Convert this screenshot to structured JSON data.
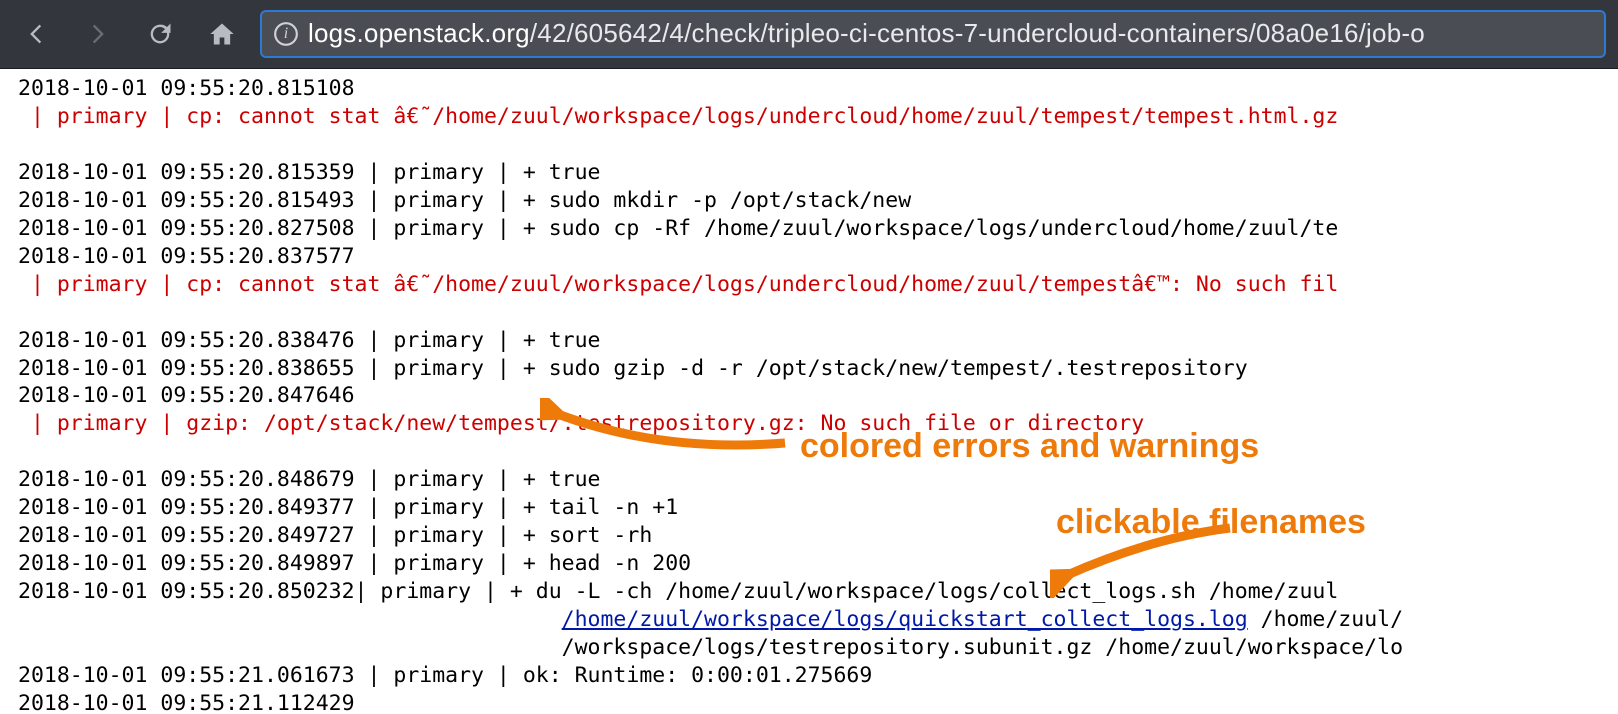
{
  "urlbar": {
    "host": "logs.openstack.org",
    "path": "/42/605642/4/check/tripleo-ci-centos-7-undercloud-containers/08a0e16/job-o"
  },
  "log": {
    "lines": [
      {
        "ts": "2018-10-01 09:55:20.815108",
        "type": "ts-only"
      },
      {
        "type": "error",
        "host": "primary",
        "msg": "cp: cannot stat â€˜/home/zuul/workspace/logs/undercloud/home/zuul/tempest/tempest.html.gz"
      },
      {
        "type": "blank"
      },
      {
        "ts": "2018-10-01 09:55:20.815359",
        "host": "primary",
        "msg": "+ true",
        "type": "normal"
      },
      {
        "ts": "2018-10-01 09:55:20.815493",
        "host": "primary",
        "msg": "+ sudo mkdir -p /opt/stack/new",
        "type": "normal"
      },
      {
        "ts": "2018-10-01 09:55:20.827508",
        "host": "primary",
        "msg": "+ sudo cp -Rf /home/zuul/workspace/logs/undercloud/home/zuul/te",
        "type": "normal"
      },
      {
        "ts": "2018-10-01 09:55:20.837577",
        "type": "ts-only"
      },
      {
        "type": "error",
        "host": "primary",
        "msg": "cp: cannot stat â€˜/home/zuul/workspace/logs/undercloud/home/zuul/tempestâ€™: No such fil"
      },
      {
        "type": "blank"
      },
      {
        "ts": "2018-10-01 09:55:20.838476",
        "host": "primary",
        "msg": "+ true",
        "type": "normal"
      },
      {
        "ts": "2018-10-01 09:55:20.838655",
        "host": "primary",
        "msg": "+ sudo gzip -d -r /opt/stack/new/tempest/.testrepository",
        "type": "normal"
      },
      {
        "ts": "2018-10-01 09:55:20.847646",
        "type": "ts-only"
      },
      {
        "type": "error",
        "host": "primary",
        "msg": "gzip: /opt/stack/new/tempest/.testrepository.gz: No such file or directory"
      },
      {
        "type": "blank"
      },
      {
        "ts": "2018-10-01 09:55:20.848679",
        "host": "primary",
        "msg": "+ true",
        "type": "normal"
      },
      {
        "ts": "2018-10-01 09:55:20.849377",
        "host": "primary",
        "msg": "+ tail -n +1",
        "type": "normal"
      },
      {
        "ts": "2018-10-01 09:55:20.849727",
        "host": "primary",
        "msg": "+ sort -rh",
        "type": "normal"
      },
      {
        "ts": "2018-10-01 09:55:20.849897",
        "host": "primary",
        "msg": "+ head -n 200",
        "type": "normal"
      },
      {
        "ts": "2018-10-01 09:55:20.850232",
        "host": "primary",
        "msg": "+ du -L -ch /home/zuul/workspace/logs/collect_logs.sh /home/zuul",
        "type": "normal-tight"
      },
      {
        "type": "cont-link",
        "linked": "/home/zuul/workspace/logs/quickstart_collect_logs.log",
        "after": " /home/zuul/"
      },
      {
        "type": "cont",
        "msg": "/workspace/logs/testrepository.subunit.gz /home/zuul/workspace/lo"
      },
      {
        "ts": "2018-10-01 09:55:21.061673",
        "host": "primary",
        "msg": "ok: Runtime: 0:00:01.275669",
        "type": "normal"
      },
      {
        "ts": "2018-10-01 09:55:21.112429",
        "type": "ts-only"
      }
    ]
  },
  "annotations": {
    "errors": "colored errors and warnings",
    "links": "clickable filenames"
  }
}
